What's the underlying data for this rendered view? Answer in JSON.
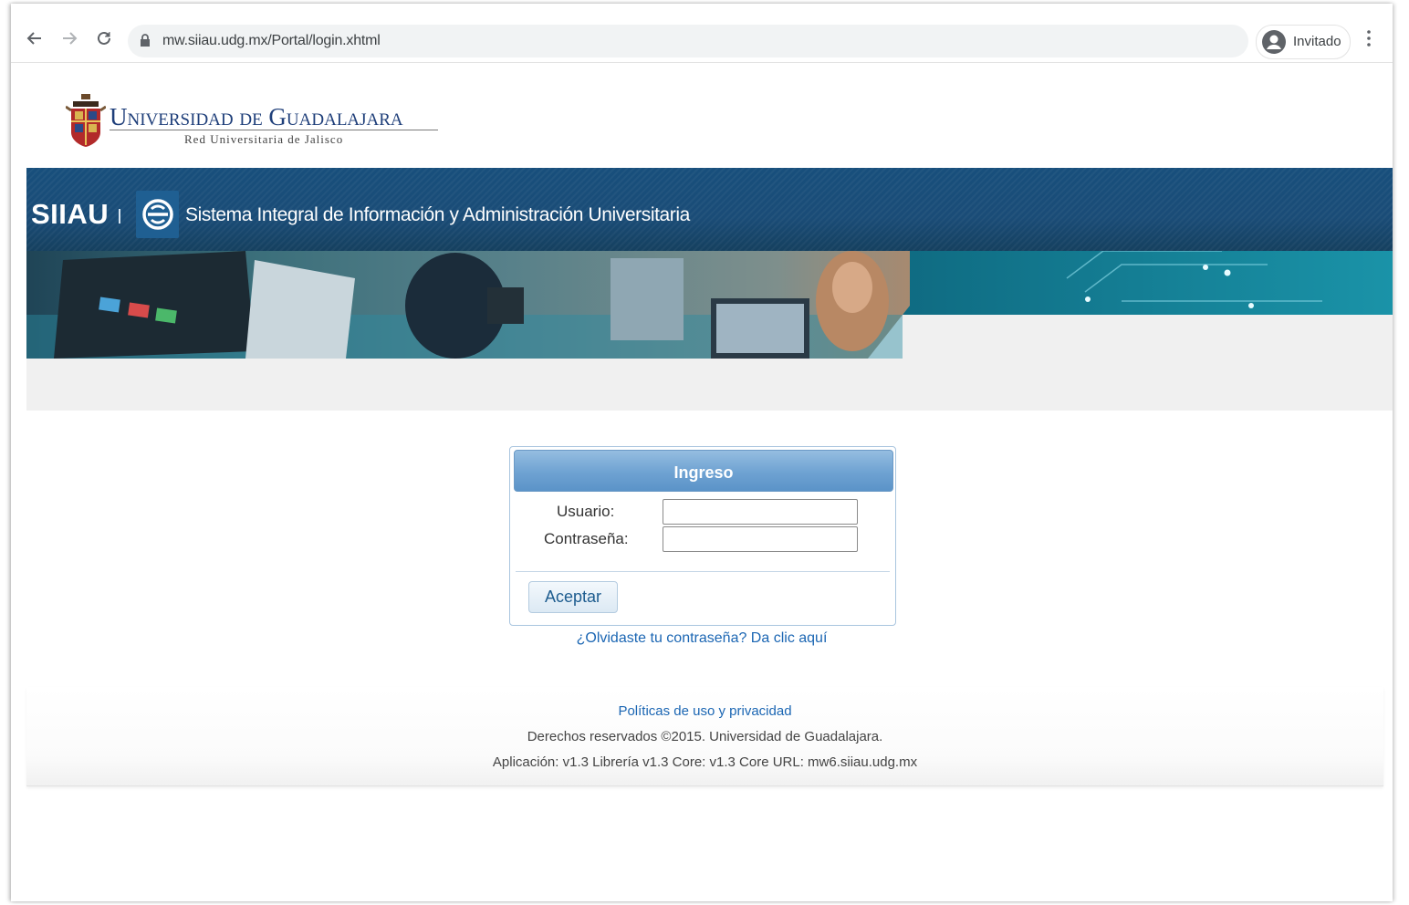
{
  "browser": {
    "url": "mw.siiau.udg.mx/Portal/login.xhtml",
    "profile_label": "Invitado"
  },
  "header": {
    "university_name": "Universidad de Guadalajara",
    "university_subtitle": "Red Universitaria de Jalisco"
  },
  "banner": {
    "brand": "SIIAU",
    "title": "Sistema Integral de Información y Administración Universitaria"
  },
  "login": {
    "title": "Ingreso",
    "user_label": "Usuario:",
    "password_label": "Contraseña:",
    "user_value": "",
    "password_value": "",
    "submit_label": "Aceptar",
    "forgot_link": "¿Olvidaste tu contraseña? Da clic aquí"
  },
  "footer": {
    "policy_link": "Políticas de uso y privacidad",
    "copyright": "Derechos reservados ©2015. Universidad de Guadalajara.",
    "version_info": "Aplicación: v1.3 Librería v1.3 Core: v1.3 Core URL: mw6.siiau.udg.mx"
  },
  "colors": {
    "banner_blue": "#1a4c77",
    "login_header": "#6ea2d2",
    "link_blue": "#1b66b3",
    "logo_text": "#1f3f7a"
  }
}
